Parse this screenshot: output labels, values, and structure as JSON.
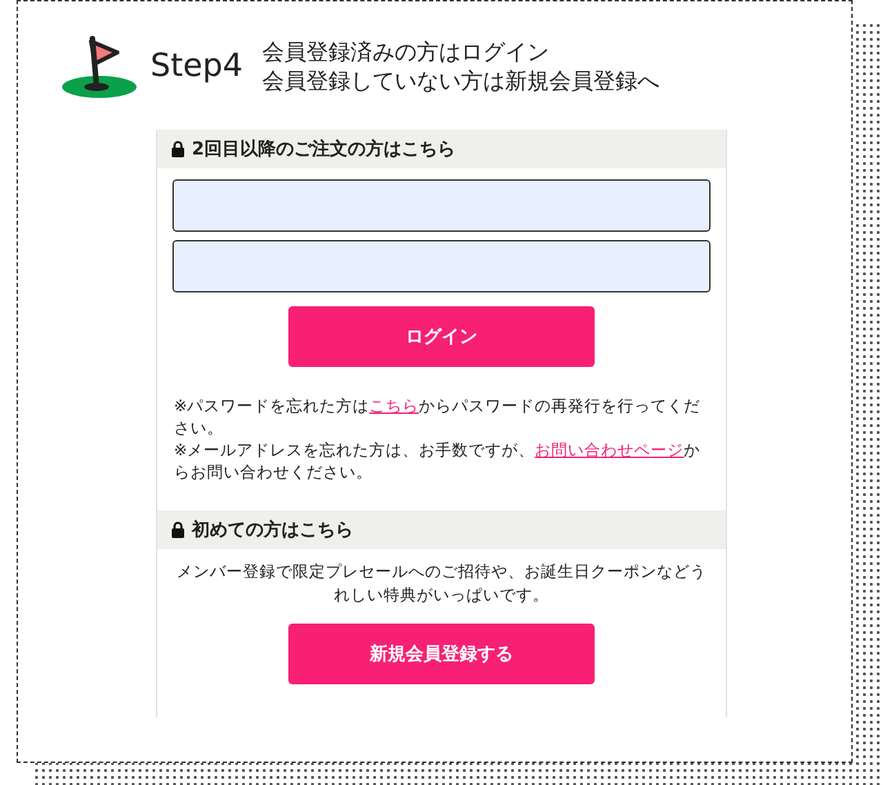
{
  "header": {
    "step": "Step4",
    "lines": [
      "会員登録済みの方はログイン",
      "会員登録していない方は新規会員登録へ"
    ]
  },
  "login": {
    "title": "2回目以降のご注文の方はこちら",
    "button": "ログイン",
    "notes": [
      {
        "before": "※パスワードを忘れた方は",
        "link": "こちら",
        "after": "からパスワードの再発行を行ってください。"
      },
      {
        "before": "※メールアドレスを忘れた方は、お手数ですが、",
        "link": "お問い合わせページ",
        "after": "からお問い合わせください。"
      }
    ]
  },
  "signup": {
    "title": "初めての方はこちら",
    "text": "メンバー登録で限定プレセールへのご招待や、お誕生日クーポンなどうれしい特典がいっぱいです。",
    "button": "新規会員登録する"
  }
}
